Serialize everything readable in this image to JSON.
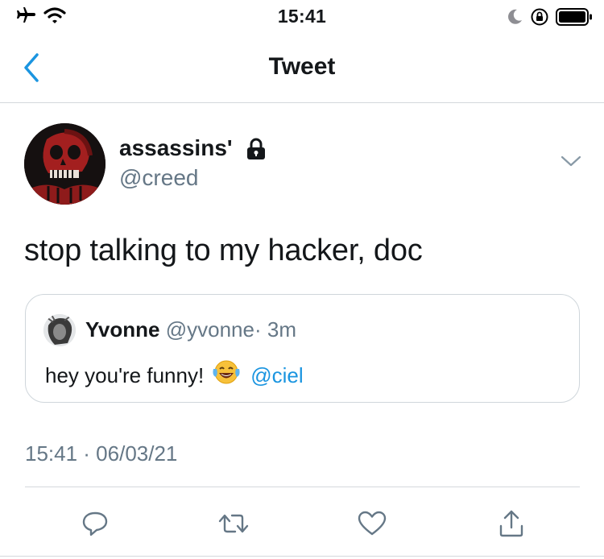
{
  "status_bar": {
    "time": "15:41",
    "left_icons": [
      "airplane-icon",
      "wifi-icon"
    ],
    "right_icons": [
      "moon-icon",
      "orientation-lock-icon",
      "battery-icon"
    ]
  },
  "nav": {
    "title": "Tweet",
    "back_icon": "chevron-left-icon"
  },
  "tweet": {
    "author_name": "assassins'",
    "author_handle": "@creed",
    "protected_icon": "lock-icon",
    "text": "stop talking to my hacker, doc",
    "timestamp": "15:41 · 06/03/21"
  },
  "quoted_tweet": {
    "author_name": "Yvonne",
    "author_handle": "@yvonne",
    "separator": "·",
    "time": "3m",
    "text": "hey you're funny!",
    "emoji": "tears-of-joy-emoji",
    "mention": "@ciel"
  },
  "actions": [
    "reply-icon",
    "retweet-icon",
    "like-icon",
    "share-icon"
  ],
  "colors": {
    "link": "#1b95e0",
    "muted": "#657786",
    "text": "#14171a",
    "border": "#cfd6db"
  }
}
